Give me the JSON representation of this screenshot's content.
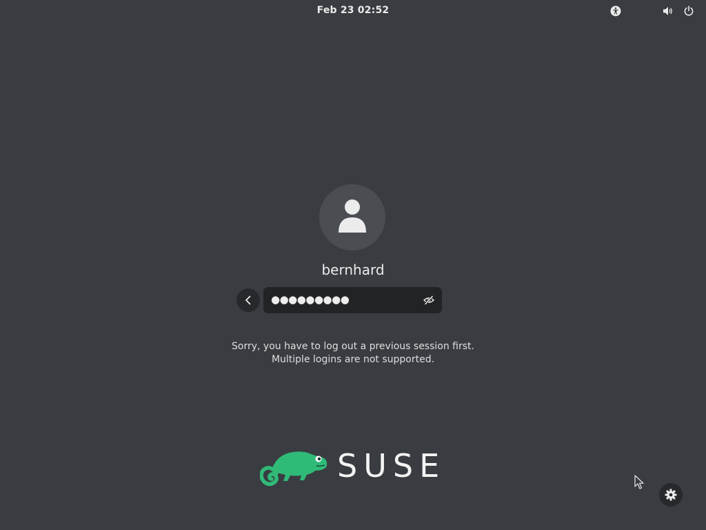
{
  "topbar": {
    "datetime": "Feb 23  02:52",
    "icons": [
      "accessibility-icon",
      "volume-icon",
      "power-icon"
    ]
  },
  "login": {
    "avatar_icon": "user-icon",
    "username": "bernhard",
    "password_masked": "●●●●●●●●●",
    "back_icon": "chevron-left-icon",
    "peek_icon": "eye-slash-icon",
    "message_line1": "Sorry, you have to log out a previous session first.",
    "message_line2": "Multiple logins are not supported."
  },
  "branding": {
    "logo_text": "SUSE",
    "logo_color": "#30ba78"
  },
  "session_settings": {
    "icon": "gear-icon"
  },
  "colors": {
    "background": "#393c40",
    "entry_background": "#222325",
    "text": "#ececec"
  }
}
